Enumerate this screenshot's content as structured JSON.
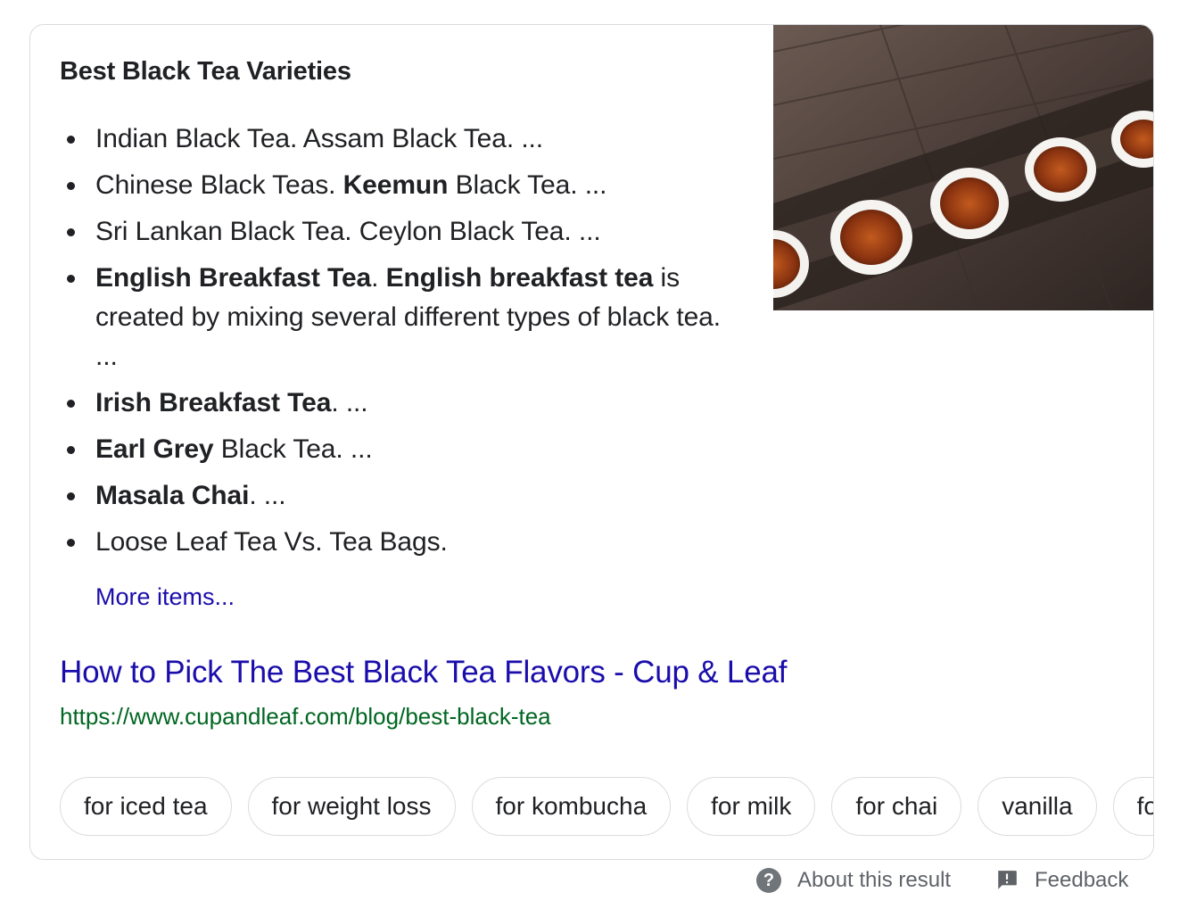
{
  "panel": {
    "heading": "Best Black Tea Varieties",
    "items": [
      [
        {
          "t": "Indian Black Tea. Assam Black Tea. ...",
          "b": false
        }
      ],
      [
        {
          "t": "Chinese Black Teas. ",
          "b": false
        },
        {
          "t": "Keemun",
          "b": true
        },
        {
          "t": " Black Tea. ...",
          "b": false
        }
      ],
      [
        {
          "t": "Sri Lankan Black Tea. Ceylon Black Tea. ...",
          "b": false
        }
      ],
      [
        {
          "t": "English Breakfast Tea",
          "b": true
        },
        {
          "t": ". ",
          "b": false
        },
        {
          "t": "English breakfast tea",
          "b": true
        },
        {
          "t": " is created by mixing several different types of black tea. ...",
          "b": false
        }
      ],
      [
        {
          "t": "Irish Breakfast Tea",
          "b": true
        },
        {
          "t": ". ...",
          "b": false
        }
      ],
      [
        {
          "t": "Earl Grey",
          "b": true
        },
        {
          "t": " Black Tea. ...",
          "b": false
        }
      ],
      [
        {
          "t": "Masala Chai",
          "b": true
        },
        {
          "t": ". ...",
          "b": false
        }
      ],
      [
        {
          "t": "Loose Leaf Tea Vs. Tea Bags.",
          "b": false
        }
      ]
    ],
    "more_link": "More items...",
    "image_icon": "tea-cups-image"
  },
  "result": {
    "title": "How to Pick The Best Black Tea Flavors - Cup & Leaf",
    "url": "https://www.cupandleaf.com/blog/best-black-tea"
  },
  "chips": [
    "for iced tea",
    "for weight loss",
    "for kombucha",
    "for milk",
    "for chai",
    "vanilla",
    "for"
  ],
  "footer": {
    "about_label": "About this result",
    "about_icon": "help-circle-icon",
    "feedback_label": "Feedback",
    "feedback_icon": "feedback-icon"
  },
  "colors": {
    "link": "#1a0dab",
    "url": "#006621",
    "text": "#202124",
    "muted": "#5f6368",
    "border": "#dadce0"
  }
}
